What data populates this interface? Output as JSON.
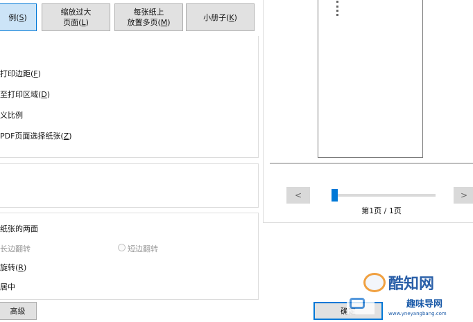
{
  "page_size_buttons": [
    {
      "label_pre": "例(",
      "key": "S",
      "label_post": ")",
      "selected": true
    },
    {
      "line1": "缩放过大",
      "line2_pre": "页面(",
      "key": "L",
      "line2_post": ")"
    },
    {
      "line1": "每张纸上",
      "line2_pre": "放置多页(",
      "key": "M",
      "line2_post": ")"
    },
    {
      "label_pre": "小册子(",
      "key": "K",
      "label_post": ")"
    }
  ],
  "size_options": [
    {
      "pre": "打印边距(",
      "key": "F",
      "post": ")"
    },
    {
      "pre": "至打印区域(",
      "key": "D",
      "post": ")"
    },
    {
      "text": "义比例"
    },
    {
      "pre": "PDF页面选择纸张(",
      "key": "Z",
      "post": ")"
    }
  ],
  "duplex": {
    "title": "纸张的两面",
    "long_edge": "长边翻转",
    "short_edge": "短边翻转",
    "rotate_pre": "旋转(",
    "rotate_key": "R",
    "rotate_post": ")",
    "center": "居中"
  },
  "advanced_button": "高级",
  "preview": {
    "prev": "<",
    "next": ">",
    "page_status": "第1页 / 1页",
    "slider_position": 0.0
  },
  "ok_button": "确定",
  "watermark": {
    "brand": "酷知网",
    "site_name": "趣味导网",
    "site_url": "www.yneyangbang.com"
  }
}
